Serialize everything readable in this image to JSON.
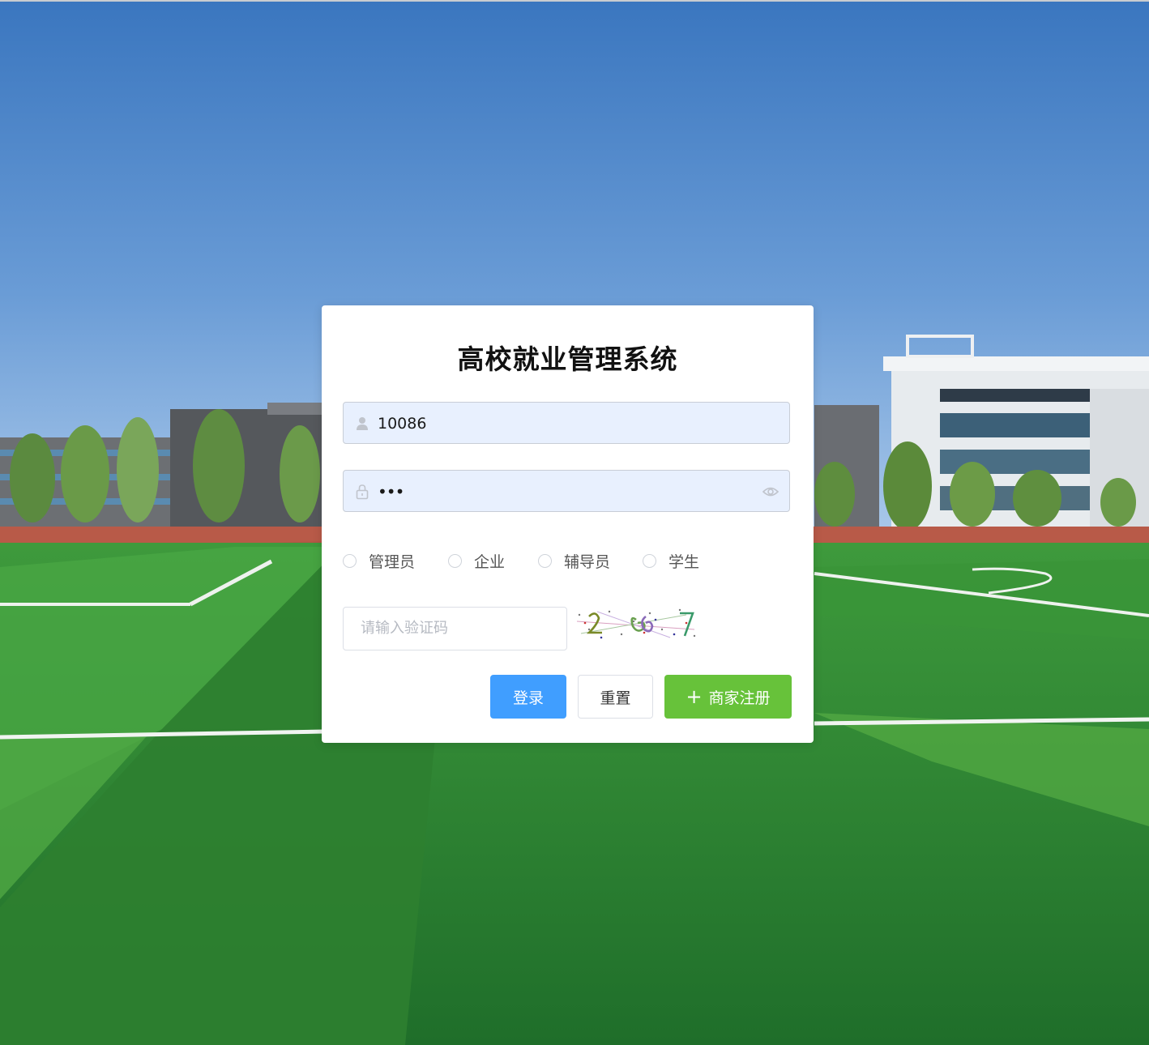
{
  "login": {
    "title": "高校就业管理系统",
    "username": {
      "value": "10086",
      "icon": "user-icon"
    },
    "password": {
      "value": "•••",
      "icon": "lock-icon",
      "toggle_icon": "eye-icon"
    },
    "roles": [
      {
        "label": "管理员",
        "selected": false
      },
      {
        "label": "企业",
        "selected": false
      },
      {
        "label": "辅导员",
        "selected": false
      },
      {
        "label": "学生",
        "selected": false
      }
    ],
    "captcha": {
      "placeholder": "请输入验证码"
    },
    "buttons": {
      "login": "登录",
      "reset": "重置",
      "register": "商家注册",
      "register_icon": "plus-icon"
    }
  },
  "colors": {
    "primary": "#409eff",
    "success": "#67c23a",
    "input_fill": "#e8f0fe"
  }
}
